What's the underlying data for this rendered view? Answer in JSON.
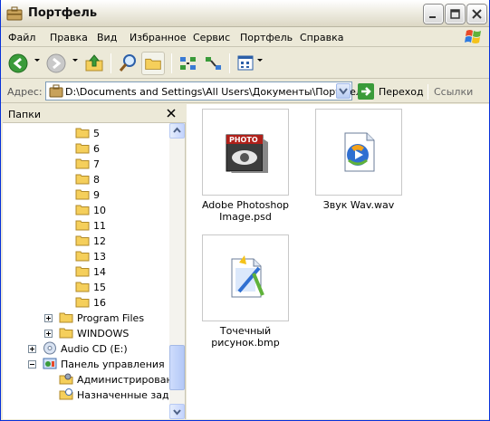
{
  "window": {
    "title": "Портфель"
  },
  "menu": {
    "items": [
      "Файл",
      "Правка",
      "Вид",
      "Избранное",
      "Сервис",
      "Портфель",
      "Справка"
    ]
  },
  "address": {
    "label": "Адрес:",
    "value": "D:\\Documents and Settings\\All Users\\Документы\\Портфель",
    "go_label": "Переход",
    "links_label": "Ссылки"
  },
  "folders": {
    "title": "Папки",
    "items": [
      {
        "label": "5",
        "icon": "folder-icon"
      },
      {
        "label": "6",
        "icon": "folder-icon"
      },
      {
        "label": "7",
        "icon": "folder-icon"
      },
      {
        "label": "8",
        "icon": "folder-icon"
      },
      {
        "label": "9",
        "icon": "folder-icon"
      },
      {
        "label": "10",
        "icon": "folder-icon"
      },
      {
        "label": "11",
        "icon": "folder-icon"
      },
      {
        "label": "12",
        "icon": "folder-icon"
      },
      {
        "label": "13",
        "icon": "folder-icon"
      },
      {
        "label": "14",
        "icon": "folder-icon"
      },
      {
        "label": "15",
        "icon": "folder-icon"
      },
      {
        "label": "16",
        "icon": "folder-icon"
      },
      {
        "label": "Program Files",
        "icon": "folder-icon"
      },
      {
        "label": "WINDOWS",
        "icon": "folder-icon"
      },
      {
        "label": "Audio CD (E:)",
        "icon": "cd-icon"
      },
      {
        "label": "Панель управления",
        "icon": "control-panel-icon"
      },
      {
        "label": "Администрирование",
        "icon": "admin-tools-icon"
      },
      {
        "label": "Назначенные задания",
        "icon": "scheduled-tasks-icon"
      }
    ]
  },
  "files": [
    {
      "name_line1": "Adobe Photoshop",
      "name_line2": "Image.psd",
      "icon": "photoshop-file-icon"
    },
    {
      "name_line1": "Звук Wav.wav",
      "name_line2": "",
      "icon": "media-file-icon"
    },
    {
      "name_line1": "Точечный рисунок.bmp",
      "name_line2": "",
      "icon": "bitmap-file-icon"
    }
  ],
  "colors": {
    "title_bar": "#ece9d8",
    "window_border": "#0831d9",
    "go_green": "#3a9b3a",
    "folder_yellow": "#f5cf5b"
  }
}
